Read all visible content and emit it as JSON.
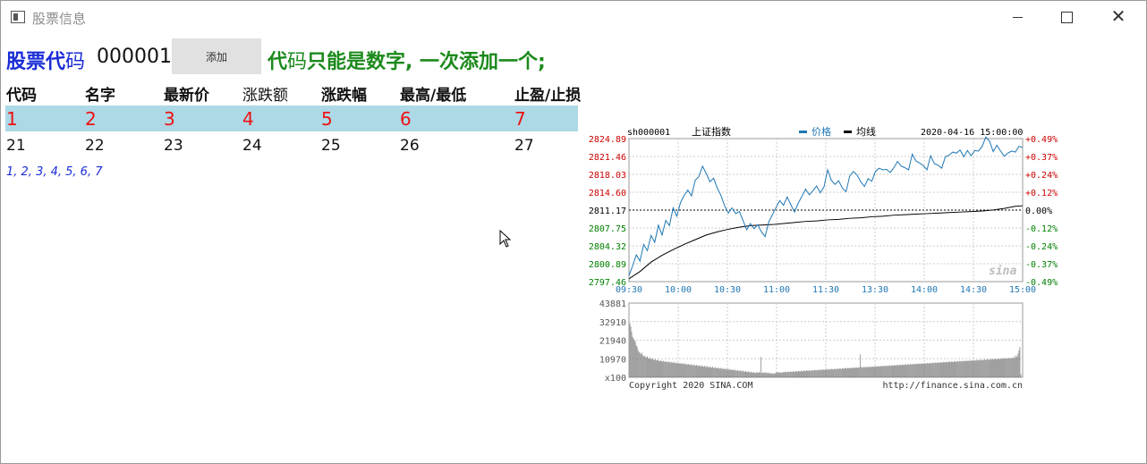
{
  "window": {
    "title": "股票信息",
    "icon": "window-icon"
  },
  "toolbar": {
    "code_label_bold": "股票代",
    "code_label_normal": "码",
    "code_value": "000001",
    "add_button": "添加",
    "hint_part1": "代",
    "hint_part2": "码",
    "hint_part3": "只能是数字, 一次添加一个;"
  },
  "table": {
    "headers": [
      "代码",
      "名字",
      "最新价",
      "涨跌额",
      "涨跌幅",
      "最高/最低",
      "止盈/止损"
    ],
    "selected_row": [
      "1",
      "2",
      "3",
      "4",
      "5",
      "6",
      "7"
    ],
    "row2": [
      "21",
      "22",
      "23",
      "24",
      "25",
      "26",
      "27"
    ],
    "list_text": "1, 2, 3, 4, 5, 6, 7"
  },
  "chart_data": {
    "type": "line",
    "symbol": "sh000001",
    "name": "上证指数",
    "legend": [
      "价格",
      "均线"
    ],
    "datetime": "2020-04-16 15:00:00",
    "colors": {
      "price": "#1f77b4",
      "avg": "#000000",
      "up": "#cc0000",
      "down": "#008000"
    },
    "y_left_ticks": [
      "2824.89",
      "2821.46",
      "2818.03",
      "2814.60",
      "2811.17",
      "2807.75",
      "2804.32",
      "2800.89",
      "2797.46"
    ],
    "y_right_ticks": [
      "+0.49%",
      "+0.37%",
      "+0.24%",
      "+0.12%",
      "0.00%",
      "-0.12%",
      "-0.24%",
      "-0.37%",
      "-0.49%"
    ],
    "x_ticks": [
      "09:30",
      "10:00",
      "10:30",
      "11:00",
      "11:30",
      "13:30",
      "14:00",
      "14:30",
      "15:00"
    ],
    "ylim": [
      2797.46,
      2824.89
    ],
    "prev_close": 2811.17,
    "price": [
      [
        0,
        2798.6
      ],
      [
        4,
        2800.5
      ],
      [
        8,
        2802.6
      ],
      [
        12,
        2801.4
      ],
      [
        16,
        2804.6
      ],
      [
        20,
        2803.4
      ],
      [
        24,
        2806.3
      ],
      [
        28,
        2805.0
      ],
      [
        32,
        2808.3
      ],
      [
        36,
        2806.4
      ],
      [
        40,
        2809.2
      ],
      [
        44,
        2808.2
      ],
      [
        48,
        2811.6
      ],
      [
        52,
        2810.0
      ],
      [
        56,
        2812.6
      ],
      [
        60,
        2814.0
      ],
      [
        64,
        2815.0
      ],
      [
        68,
        2813.9
      ],
      [
        72,
        2816.9
      ],
      [
        76,
        2817.6
      ],
      [
        80,
        2819.6
      ],
      [
        84,
        2818.2
      ],
      [
        88,
        2816.6
      ],
      [
        92,
        2817.3
      ],
      [
        96,
        2815.4
      ],
      [
        100,
        2814.0
      ],
      [
        104,
        2812.0
      ],
      [
        108,
        2810.6
      ],
      [
        112,
        2811.6
      ],
      [
        116,
        2810.5
      ],
      [
        120,
        2810.9
      ],
      [
        124,
        2809.2
      ],
      [
        128,
        2807.4
      ],
      [
        132,
        2808.6
      ],
      [
        136,
        2807.6
      ],
      [
        140,
        2808.4
      ],
      [
        144,
        2807.0
      ],
      [
        148,
        2806.1
      ],
      [
        152,
        2808.9
      ],
      [
        156,
        2810.3
      ],
      [
        160,
        2811.7
      ],
      [
        164,
        2813.0
      ],
      [
        168,
        2812.1
      ],
      [
        172,
        2813.7
      ],
      [
        176,
        2812.2
      ],
      [
        180,
        2810.8
      ],
      [
        184,
        2812.5
      ],
      [
        188,
        2813.8
      ],
      [
        192,
        2815.2
      ],
      [
        196,
        2814.1
      ],
      [
        200,
        2814.9
      ],
      [
        204,
        2815.8
      ],
      [
        208,
        2814.5
      ],
      [
        212,
        2815.6
      ],
      [
        216,
        2818.9
      ],
      [
        220,
        2816.9
      ],
      [
        224,
        2816.1
      ],
      [
        228,
        2816.8
      ],
      [
        232,
        2815.4
      ],
      [
        236,
        2814.7
      ],
      [
        240,
        2817.7
      ],
      [
        244,
        2818.6
      ],
      [
        248,
        2817.9
      ],
      [
        252,
        2816.6
      ],
      [
        256,
        2815.7
      ],
      [
        260,
        2817.2
      ],
      [
        264,
        2816.7
      ],
      [
        268,
        2818.6
      ],
      [
        272,
        2819.2
      ],
      [
        276,
        2818.9
      ],
      [
        280,
        2819.0
      ],
      [
        284,
        2818.4
      ],
      [
        288,
        2819.3
      ],
      [
        292,
        2820.5
      ],
      [
        296,
        2819.6
      ],
      [
        300,
        2819.3
      ],
      [
        304,
        2818.9
      ],
      [
        308,
        2821.9
      ],
      [
        312,
        2820.6
      ],
      [
        316,
        2820.2
      ],
      [
        320,
        2819.7
      ],
      [
        324,
        2818.9
      ],
      [
        328,
        2821.6
      ],
      [
        332,
        2820.1
      ],
      [
        336,
        2819.8
      ],
      [
        340,
        2819.2
      ],
      [
        344,
        2821.4
      ],
      [
        348,
        2821.7
      ],
      [
        352,
        2822.3
      ],
      [
        356,
        2822.1
      ],
      [
        360,
        2822.7
      ],
      [
        364,
        2821.4
      ],
      [
        368,
        2822.6
      ],
      [
        372,
        2821.6
      ],
      [
        376,
        2822.6
      ],
      [
        380,
        2822.5
      ],
      [
        384,
        2823.4
      ],
      [
        388,
        2825.2
      ],
      [
        392,
        2824.4
      ],
      [
        396,
        2822.4
      ],
      [
        400,
        2823.6
      ],
      [
        404,
        2822.5
      ],
      [
        408,
        2821.5
      ],
      [
        412,
        2822.1
      ],
      [
        416,
        2822.5
      ],
      [
        420,
        2822.3
      ],
      [
        424,
        2823.4
      ],
      [
        428,
        2823.2
      ]
    ],
    "avg": [
      [
        0,
        2798.0
      ],
      [
        12,
        2799.4
      ],
      [
        24,
        2801.2
      ],
      [
        36,
        2802.5
      ],
      [
        48,
        2803.6
      ],
      [
        60,
        2804.6
      ],
      [
        72,
        2805.5
      ],
      [
        84,
        2806.4
      ],
      [
        96,
        2807.0
      ],
      [
        108,
        2807.5
      ],
      [
        120,
        2807.9
      ],
      [
        132,
        2808.2
      ],
      [
        144,
        2808.3
      ],
      [
        156,
        2808.4
      ],
      [
        168,
        2808.6
      ],
      [
        180,
        2808.8
      ],
      [
        192,
        2809.0
      ],
      [
        204,
        2809.1
      ],
      [
        216,
        2809.3
      ],
      [
        228,
        2809.4
      ],
      [
        240,
        2809.6
      ],
      [
        252,
        2809.7
      ],
      [
        264,
        2809.9
      ],
      [
        276,
        2810.0
      ],
      [
        288,
        2810.2
      ],
      [
        300,
        2810.3
      ],
      [
        312,
        2810.4
      ],
      [
        324,
        2810.5
      ],
      [
        336,
        2810.6
      ],
      [
        348,
        2810.7
      ],
      [
        360,
        2810.8
      ],
      [
        372,
        2810.9
      ],
      [
        384,
        2811.0
      ],
      [
        396,
        2811.2
      ],
      [
        408,
        2811.5
      ],
      [
        420,
        2811.9
      ],
      [
        428,
        2812.0
      ]
    ],
    "volume_ticks": [
      "43881",
      "32910",
      "21940",
      "10970",
      "x100"
    ],
    "volume_max": 43881,
    "volume": [
      32000,
      30000,
      27000,
      24000,
      23000,
      22000,
      21000,
      19000,
      18000,
      16000,
      15000,
      14500,
      13800,
      14600,
      13000,
      12500,
      12800,
      12000,
      11800,
      12400,
      11300,
      11000,
      11600,
      10800,
      10600,
      11200,
      10400,
      10200,
      10700,
      10100,
      9900,
      10400,
      9700,
      9600,
      10000,
      9500,
      9300,
      9800,
      9200,
      9100,
      9600,
      9000,
      8900,
      9400,
      8800,
      8700,
      9200,
      8600,
      8500,
      9100,
      8400,
      8300,
      8800,
      8200,
      8100,
      8600,
      8000,
      7900,
      8400,
      7800,
      7700,
      8200,
      7600,
      7500,
      8000,
      7400,
      7300,
      7800,
      7200,
      7100,
      7600,
      7000,
      6900,
      7400,
      6800,
      6700,
      7200,
      6600,
      6500,
      7000,
      6400,
      6300,
      6800,
      6200,
      6100,
      6600,
      6000,
      5900,
      6400,
      5800,
      5700,
      6200,
      5600,
      5500,
      6000,
      5400,
      5300,
      5800,
      5200,
      5100,
      5600,
      5000,
      4900,
      5400,
      4800,
      4700,
      5200,
      4600,
      4500,
      5000,
      4400,
      4300,
      4800,
      4200,
      4100,
      4600,
      4000,
      3900,
      4400,
      3800,
      3700,
      4200,
      3600,
      3500,
      4000,
      3400,
      3300,
      3800,
      3200,
      3100,
      3600,
      3000,
      2900,
      3400,
      2800,
      2700,
      3200,
      2600,
      2500,
      3000,
      2800,
      2700,
      3200,
      2600,
      12000,
      2500,
      3000,
      2700,
      2600,
      3100,
      2500,
      2400,
      2900,
      2300,
      2200,
      2700,
      2100,
      2000,
      2500,
      2200,
      2600,
      2800,
      3100,
      2900,
      2700,
      3000,
      2800,
      2600,
      3200,
      3000,
      3300,
      3100,
      2900,
      3400,
      3200,
      3000,
      3500,
      3300,
      3100,
      3600,
      3400,
      3200,
      3700,
      3500,
      3300,
      3800,
      3600,
      3400,
      3900,
      3700,
      3500,
      4000,
      3800,
      3600,
      4100,
      3900,
      3700,
      4200,
      4000,
      3800,
      4300,
      4100,
      3900,
      4400,
      4200,
      4000,
      4500,
      4300,
      4100,
      4600,
      4400,
      4200,
      4700,
      4500,
      4300,
      4800,
      4600,
      4400,
      4900,
      4700,
      4500,
      5000,
      4800,
      4600,
      5100,
      4900,
      4700,
      5200,
      5000,
      4800,
      5300,
      5100,
      4900,
      5400,
      5200,
      5000,
      5500,
      5300,
      5100,
      5600,
      5400,
      5200,
      5700,
      5500,
      5300,
      5800,
      5600,
      5400,
      5900,
      5700,
      5500,
      6000,
      5800,
      13500,
      6100,
      5900,
      5700,
      6200,
      6000,
      5800,
      6300,
      6100,
      5900,
      6400,
      6200,
      6000,
      6500,
      6300,
      6100,
      6600,
      6400,
      6200,
      6700,
      6500,
      6300,
      6800,
      6600,
      6400,
      6900,
      6700,
      6500,
      7000,
      6800,
      6600,
      7100,
      6900,
      6700,
      7200,
      7000,
      6800,
      7300,
      7100,
      6900,
      7400,
      7200,
      7000,
      7500,
      7300,
      7100,
      7600,
      7400,
      7200,
      7700,
      7500,
      7300,
      7800,
      7600,
      7400,
      7900,
      7700,
      7500,
      8000,
      7800,
      7600,
      8100,
      7900,
      7700,
      8200,
      8000,
      7800,
      8300,
      8100,
      7900,
      8400,
      8200,
      8000,
      8500,
      8300,
      8100,
      8600,
      8400,
      8200,
      8700,
      8500,
      8300,
      8800,
      8600,
      8400,
      8900,
      8700,
      8500,
      9000,
      8800,
      8600,
      9100,
      8900,
      8700,
      9200,
      9000,
      8800,
      9300,
      9100,
      8900,
      9400,
      9200,
      9000,
      9500,
      9300,
      9100,
      9600,
      9400,
      9200,
      9700,
      9500,
      9300,
      9800,
      9600,
      9400,
      9900,
      9700,
      9500,
      10000,
      9800,
      9600,
      10100,
      9900,
      9700,
      10200,
      10000,
      9800,
      10300,
      10100,
      9900,
      10400,
      10200,
      10000,
      10500,
      10300,
      10100,
      10600,
      10400,
      10200,
      10700,
      10500,
      10300,
      10800,
      10600,
      10400,
      10900,
      10700,
      10500,
      11000,
      10800,
      10600,
      11100,
      10900,
      10700,
      11200,
      11000,
      10800,
      11300,
      11100,
      10900,
      11400,
      11200,
      11000,
      11500,
      11300,
      11100,
      11600,
      11400,
      11200,
      12500,
      11500,
      13000,
      12000,
      14000,
      16000,
      18000,
      2000
    ],
    "copyright": "Copyright 2020 SINA.COM",
    "url": "http://finance.sina.com.cn",
    "watermark": "sina"
  }
}
